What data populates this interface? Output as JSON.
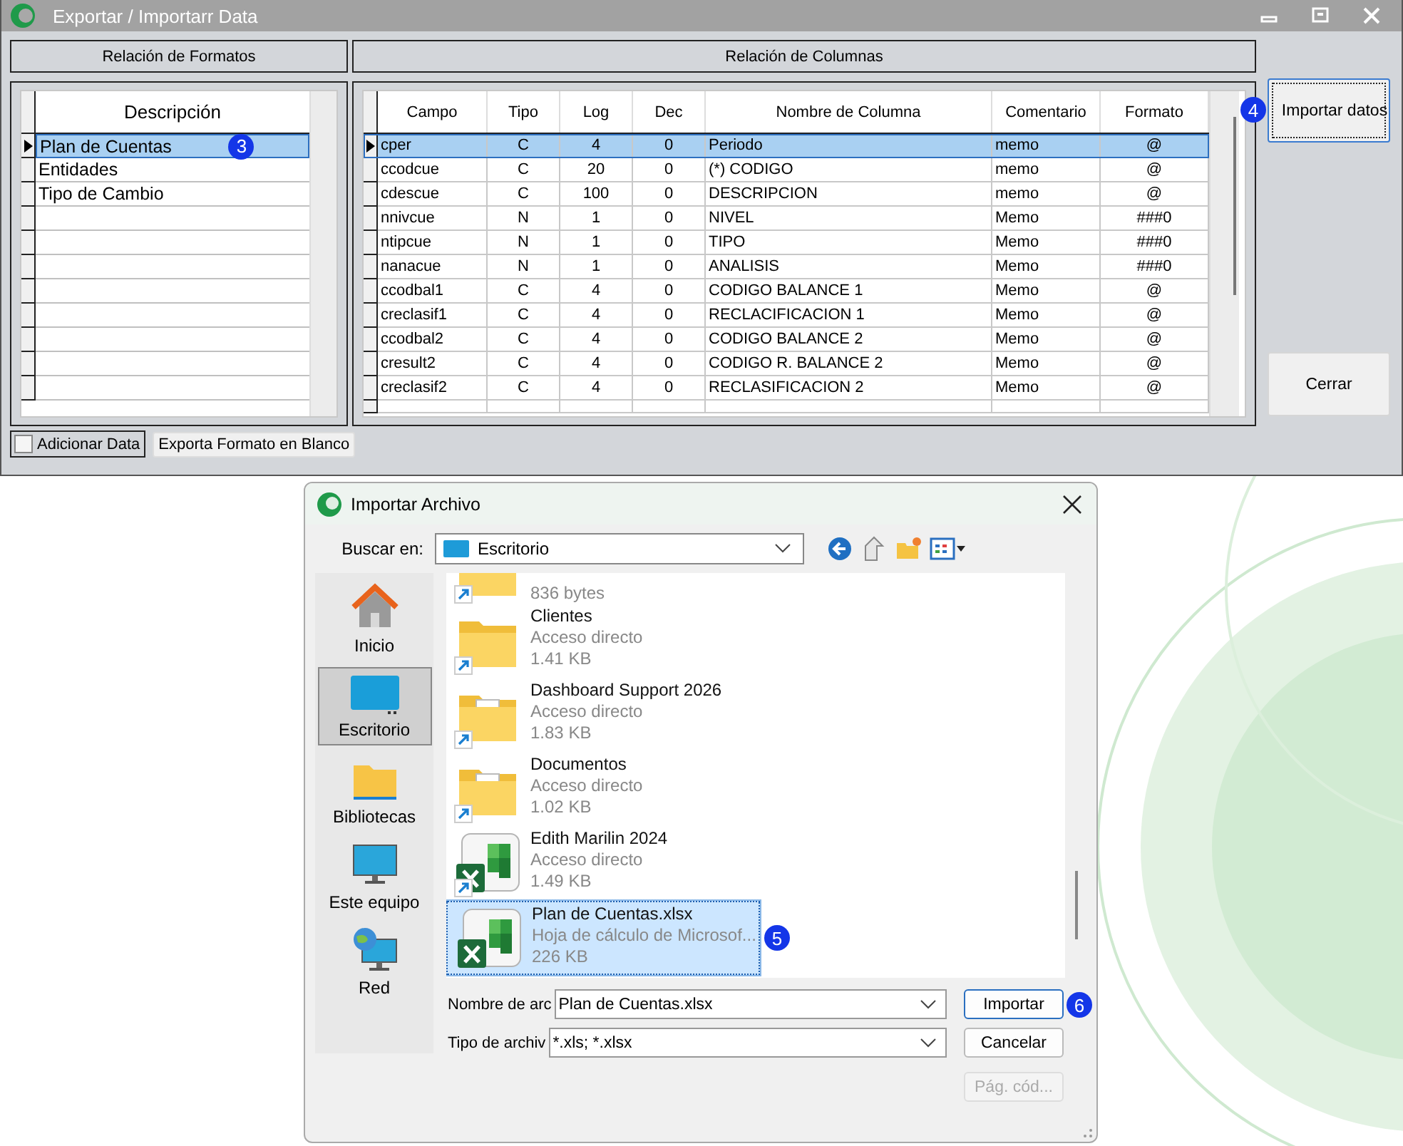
{
  "window": {
    "title": "Exportar / Importarr Data"
  },
  "formats_panel": {
    "header": "Relación de Formatos",
    "column": "Descripción",
    "rows": [
      {
        "text": "Plan de Cuentas",
        "selected": true,
        "badge": "3"
      },
      {
        "text": "Entidades",
        "selected": false
      },
      {
        "text": "Tipo de Cambio",
        "selected": false
      }
    ]
  },
  "columns_panel": {
    "header": "Relación de Columnas",
    "columns": [
      "Campo",
      "Tipo",
      "Log",
      "Dec",
      "Nombre de Columna",
      "Comentario",
      "Formato"
    ],
    "rows": [
      {
        "cells": [
          "cper",
          "C",
          "4",
          "0",
          "Periodo",
          "memo",
          "@"
        ],
        "selected": true
      },
      {
        "cells": [
          "ccodcue",
          "C",
          "20",
          "0",
          "(*) CODIGO",
          "memo",
          "@"
        ],
        "selected": false
      },
      {
        "cells": [
          "cdescue",
          "C",
          "100",
          "0",
          "DESCRIPCION",
          "memo",
          "@"
        ],
        "selected": false
      },
      {
        "cells": [
          "nnivcue",
          "N",
          "1",
          "0",
          "NIVEL",
          "Memo",
          "###0"
        ],
        "selected": false
      },
      {
        "cells": [
          "ntipcue",
          "N",
          "1",
          "0",
          "TIPO",
          "Memo",
          "###0"
        ],
        "selected": false
      },
      {
        "cells": [
          "nanacue",
          "N",
          "1",
          "0",
          "ANALISIS",
          "Memo",
          "###0"
        ],
        "selected": false
      },
      {
        "cells": [
          "ccodbal1",
          "C",
          "4",
          "0",
          "CODIGO BALANCE 1",
          "Memo",
          "@"
        ],
        "selected": false
      },
      {
        "cells": [
          "creclasif1",
          "C",
          "4",
          "0",
          "RECLACIFICACION 1",
          "Memo",
          "@"
        ],
        "selected": false
      },
      {
        "cells": [
          "ccodbal2",
          "C",
          "4",
          "0",
          "CODIGO BALANCE 2",
          "Memo",
          "@"
        ],
        "selected": false
      },
      {
        "cells": [
          "cresult2",
          "C",
          "4",
          "0",
          "CODIGO R. BALANCE 2",
          "Memo",
          "@"
        ],
        "selected": false
      },
      {
        "cells": [
          "creclasif2",
          "C",
          "4",
          "0",
          "RECLASIFICACION 2",
          "Memo",
          "@"
        ],
        "selected": false
      }
    ]
  },
  "side_buttons": [
    {
      "label": "Importar datos",
      "badge": "4",
      "focused": true
    },
    {
      "label": "Cerrar",
      "focused": false
    }
  ],
  "add_data": {
    "label": "Adicionar Data",
    "checked": false
  },
  "export_blank_button": {
    "label": "Exporta Formato en Blanco"
  },
  "dialog": {
    "title": "Importar Archivo",
    "look_in": {
      "label": "Buscar en:",
      "value": "Escritorio"
    },
    "places": [
      {
        "label": "Inicio",
        "kind": "home",
        "selected": false
      },
      {
        "label": "Escritorio",
        "kind": "desktop",
        "selected": true
      },
      {
        "label": "Bibliotecas",
        "kind": "library",
        "selected": false
      },
      {
        "label": "Este equipo",
        "kind": "computer",
        "selected": false
      },
      {
        "label": "Red",
        "kind": "network",
        "selected": false
      }
    ],
    "files": [
      {
        "kind": "folder",
        "shortcut": true,
        "size": "836 bytes",
        "selected": false
      },
      {
        "kind": "folder",
        "shortcut": true,
        "name": "Clientes",
        "type": "Acceso directo",
        "size": "1.41 KB",
        "selected": false
      },
      {
        "kind": "folder-doc",
        "shortcut": true,
        "name": "Dashboard Support 2026",
        "type": "Acceso directo",
        "size": "1.83 KB",
        "selected": false
      },
      {
        "kind": "folder-excel",
        "shortcut": true,
        "name": "Documentos",
        "type": "Acceso directo",
        "size": "1.02 KB",
        "selected": false
      },
      {
        "kind": "excel",
        "shortcut": true,
        "name": "Edith Marilin 2024",
        "type": "Acceso directo",
        "size": "1.49 KB",
        "selected": false
      },
      {
        "kind": "excel",
        "shortcut": false,
        "name": "Plan de Cuentas.xlsx",
        "type": "Hoja de cálculo de Microsof...",
        "size": "226 KB",
        "selected": true,
        "badge": "5"
      }
    ],
    "file_name": {
      "label": "Nombre de arc",
      "value": "Plan de Cuentas.xlsx"
    },
    "file_type": {
      "label": "Tipo de archiv",
      "value": "*.xls; *.xlsx"
    },
    "buttons": [
      {
        "label": "Importar",
        "badge": "6",
        "disabled": false,
        "focused": true
      },
      {
        "label": "Cancelar",
        "disabled": false,
        "focused": false
      },
      {
        "label": "Pág. cód...",
        "disabled": true,
        "focused": false
      }
    ]
  }
}
